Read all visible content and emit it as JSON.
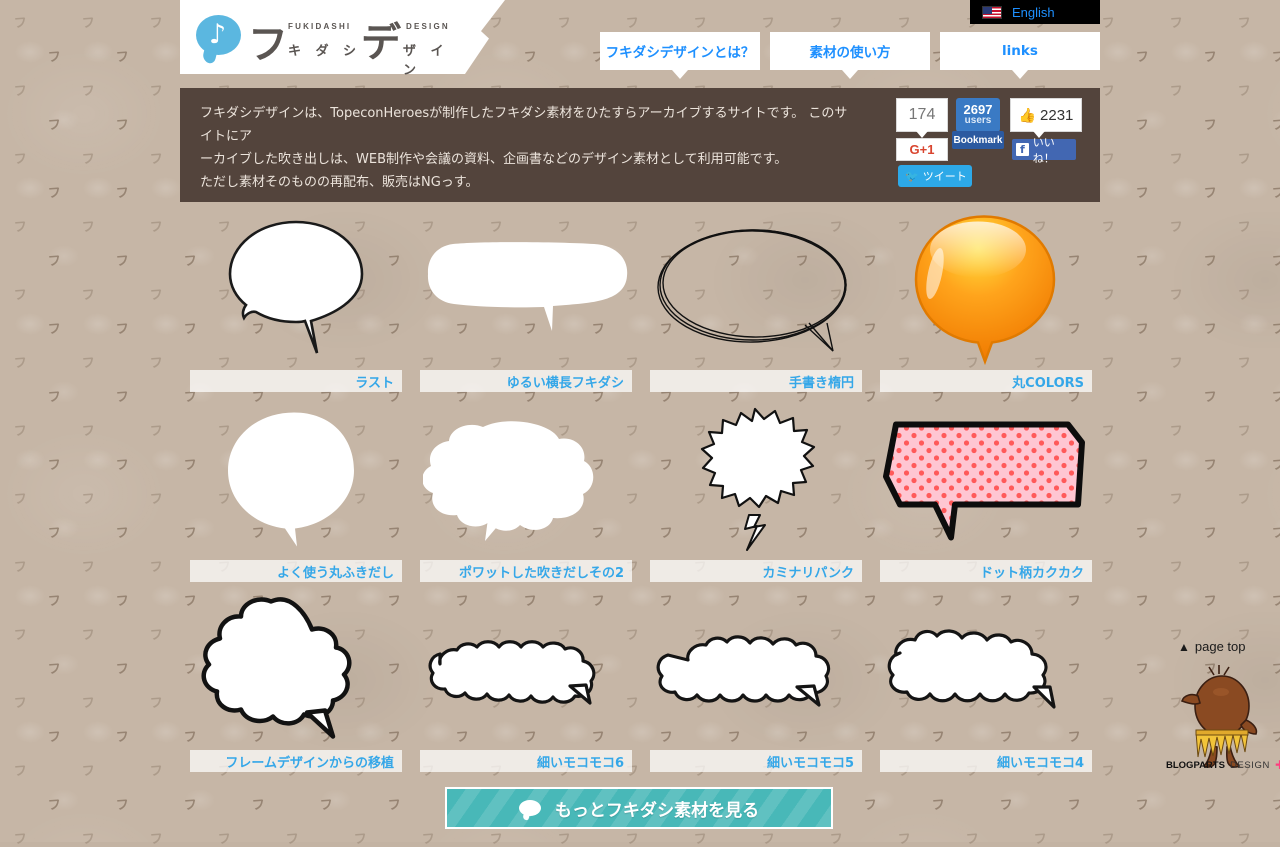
{
  "site": {
    "logo": {
      "mark_icon": "speech-bubble-music-note-icon",
      "big1": "フ",
      "big2": "デ",
      "kana1": "キ ダ シ",
      "kana2": "ザ イ ン",
      "tiny1": "FUKIDASHI",
      "tiny2": "DESIGN"
    },
    "language_switch": {
      "icon": "us-flag-icon",
      "label": "English"
    }
  },
  "nav": {
    "tabs": [
      {
        "label": "フキダシデザインとは？"
      },
      {
        "label": "素材の使い方"
      },
      {
        "label": "links"
      }
    ]
  },
  "description": {
    "lines": [
      "フキダシデザインは、TopeconHeroesが制作したフキダシ素材をひたすらアーカイブするサイトです。 このサイトにア",
      "ーカイブした吹き出しは、WEB制作や会議の資料、企画書などのデザイン素材として利用可能です。",
      "ただし素材そのものの再配布、販売はNGっす。"
    ]
  },
  "social": {
    "googleplus": {
      "count": "174",
      "button_label": "G+1",
      "icon": "google-plus-icon"
    },
    "hatena": {
      "count": "2697",
      "unit": "users",
      "button_label": "Bookmark"
    },
    "facebook": {
      "count": "2231",
      "thumb_icon": "thumbs-up-icon",
      "button_label": "いいね！",
      "icon": "facebook-f-icon"
    },
    "twitter": {
      "button_label": "ツイート",
      "icon": "twitter-bird-icon"
    }
  },
  "gallery": {
    "rows": [
      [
        {
          "label": "ラスト",
          "shape": "round-cloud-bubble"
        },
        {
          "label": "ゆるい横長フキダシ",
          "shape": "loose-wide-bubble"
        },
        {
          "label": "手書き楕円",
          "shape": "handdrawn-ellipse-bubble"
        },
        {
          "label": "丸COLORS",
          "shape": "glossy-orange-round-bubble"
        }
      ],
      [
        {
          "label": "よく使う丸ふきだし",
          "shape": "plain-round-bubble"
        },
        {
          "label": "ポワットした吹きだしその2",
          "shape": "puffy-bubble-2"
        },
        {
          "label": "カミナリパンク",
          "shape": "spiky-lightning-bubble"
        },
        {
          "label": "ドット柄カクカク",
          "shape": "pink-dotted-angular-bubble"
        }
      ],
      [
        {
          "label": "フレームデザインからの移植",
          "shape": "big-cloud-bubble"
        },
        {
          "label": "細いモコモコ6",
          "shape": "thin-fluffy-bubble-6"
        },
        {
          "label": "細いモコモコ5",
          "shape": "thin-fluffy-bubble-5"
        },
        {
          "label": "細いモコモコ4",
          "shape": "thin-fluffy-bubble-4"
        }
      ]
    ]
  },
  "more_button": {
    "label": "もっとフキダシ素材を見る",
    "icon": "speech-bubble-icon"
  },
  "footer": {
    "page_top": {
      "label": "page top",
      "icon": "arrow-up-icon"
    },
    "mascot": "blogparts-mascot",
    "brand_bold": "BLOGPARTS",
    "brand_light": "DESIGN",
    "brand_plus": "✚"
  },
  "colors": {
    "background": "#c6b6a6",
    "panel": "#53443c",
    "link_blue": "#35a7e8",
    "nav_blue": "#1e90ff",
    "teal_button": "#48b8b8",
    "orange_bubble": "#ff9f1a",
    "pink_bubble": "#ffc2cf"
  }
}
